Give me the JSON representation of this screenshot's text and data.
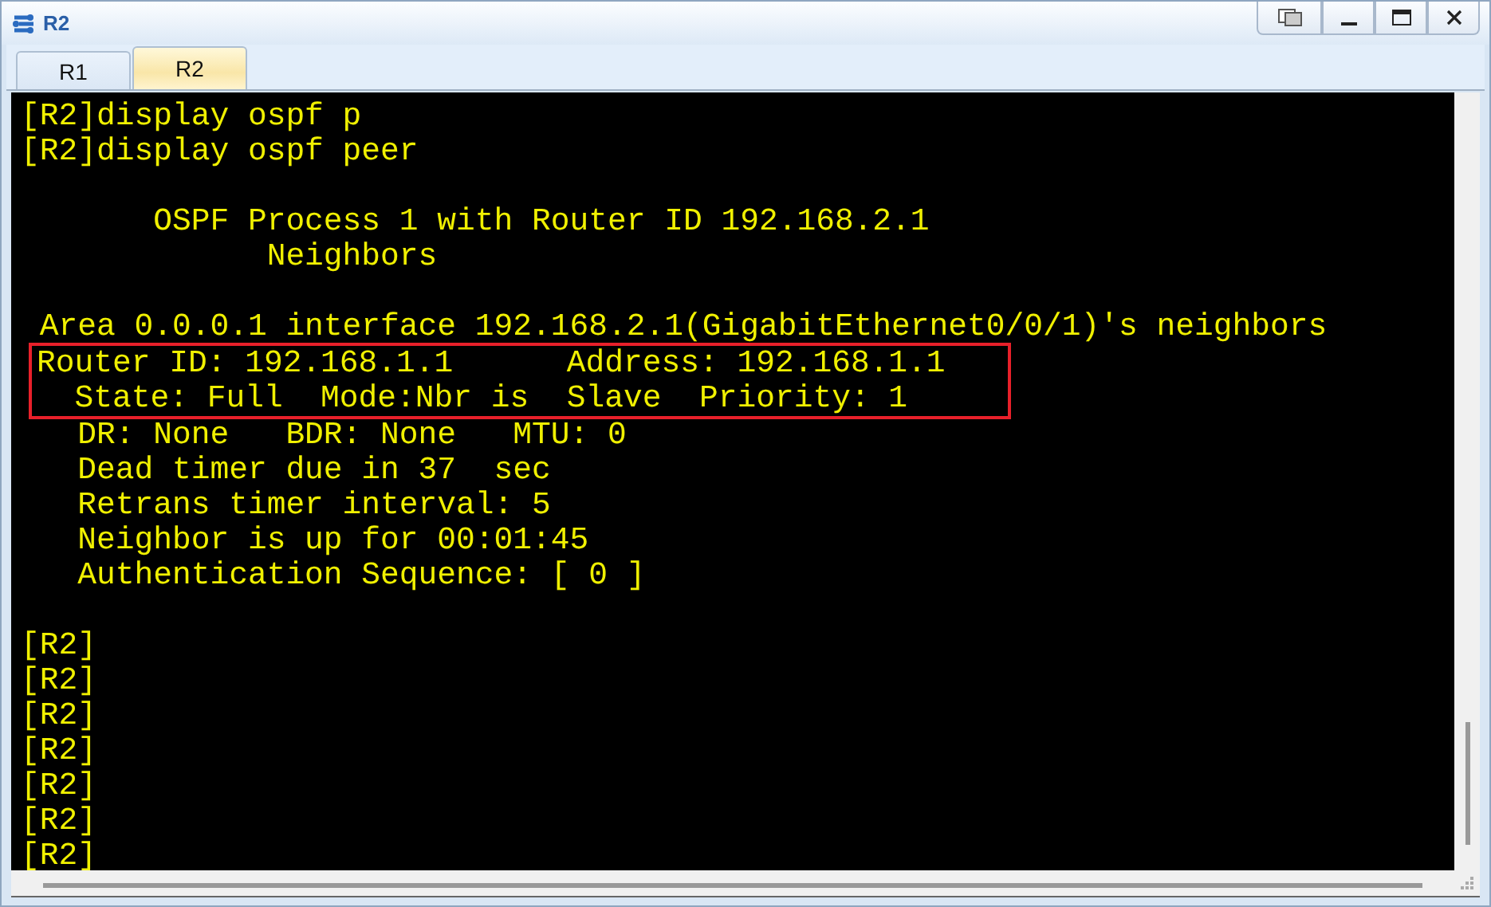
{
  "window": {
    "title": "R2"
  },
  "tabs": [
    {
      "label": "R1",
      "selected": false
    },
    {
      "label": "R2",
      "selected": true
    }
  ],
  "terminal": {
    "blocks": [
      {
        "lines": [
          "[R2]display ospf p",
          "[R2]display ospf peer"
        ]
      },
      {
        "lines": [
          "       OSPF Process 1 with Router ID 192.168.2.1",
          "             Neighbors"
        ]
      },
      {
        "lines": [
          " Area 0.0.0.1 interface 192.168.2.1(GigabitEthernet0/0/1)'s neighbors"
        ],
        "highlighted": [
          "Router ID: 192.168.1.1      Address: 192.168.1.1",
          "  State: Full  Mode:Nbr is  Slave  Priority: 1"
        ],
        "lines_after": [
          "   DR: None   BDR: None   MTU: 0",
          "   Dead timer due in 37  sec",
          "   Retrans timer interval: 5",
          "   Neighbor is up for 00:01:45",
          "   Authentication Sequence: [ 0 ]"
        ]
      },
      {
        "lines": [
          "[R2]",
          "[R2]",
          "[R2]",
          "[R2]",
          "[R2]",
          "[R2]",
          "[R2]"
        ]
      }
    ]
  }
}
